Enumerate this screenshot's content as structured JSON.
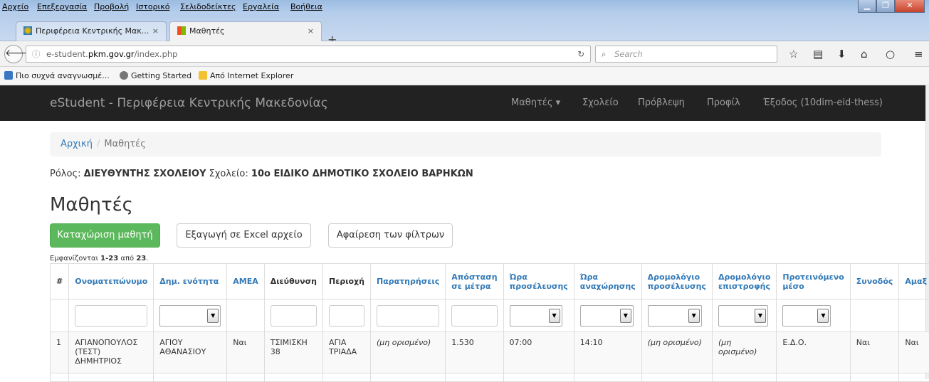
{
  "browser": {
    "menu": [
      "Αρχείο",
      "Επεξεργασία",
      "Προβολή",
      "Ιστορικό",
      "Σελιδοδείκτες",
      "Εργαλεία",
      "Βοήθεια"
    ],
    "tabs": [
      {
        "title": "Περιφέρεια Κεντρικής Μακ...",
        "close": "×"
      },
      {
        "title": "Μαθητές",
        "close": "×"
      }
    ],
    "new_tab": "+",
    "url_prefix": "e-student.",
    "url_domain": "pkm.gov.gr",
    "url_path": "/index.php",
    "search_placeholder": "Search",
    "bookmarks": [
      "Πιο συχνά αναγνωσμέ...",
      "Getting Started",
      "Από Internet Explorer"
    ]
  },
  "app": {
    "brand": "eStudent - Περιφέρεια Κεντρικής Μακεδονίας",
    "nav": [
      "Μαθητές ▾",
      "Σχολείο",
      "Πρόβλεψη",
      "Προφίλ",
      "Έξοδος (10dim-eid-thess)"
    ]
  },
  "breadcrumb": {
    "home": "Αρχική",
    "sep": "/",
    "current": "Μαθητές"
  },
  "role": {
    "role_label": "Ρόλος:",
    "role_value": "ΔΙΕΥΘΥΝΤΗΣ ΣΧΟΛΕΙΟΥ",
    "school_label": "Σχολείο:",
    "school_value": "10ο ΕΙΔΙΚΟ ΔΗΜΟΤΙΚΟ ΣΧΟΛΕΙΟ ΒΑΡΗΚΩΝ"
  },
  "page_title": "Μαθητές",
  "buttons": {
    "add": "Καταχώριση μαθητή",
    "export": "Εξαγωγή σε Excel αρχείο",
    "clear": "Αφαίρεση των φίλτρων"
  },
  "summary": {
    "prefix": "Εμφανίζονται",
    "range": "1-23",
    "mid": "από",
    "total": "23",
    "end": "."
  },
  "table": {
    "headers": [
      "#",
      "Ονοματεπώνυμο",
      "Δημ. ενότητα",
      "ΑΜΕΑ",
      "Διεύθυνση",
      "Περιοχή",
      "Παρατηρήσεις",
      "Απόσταση σε μέτρα",
      "Ώρα προσέλευσης",
      "Ώρα αναχώρησης",
      "Δρομολόγιο προσέλευσης",
      "Δρομολόγιο επιστροφής",
      "Προτεινόμενο μέσο",
      "Συνοδός",
      "Αμαξ"
    ],
    "rows": [
      [
        "1",
        "ΑΓΙΑΝΟΠΟΥΛΟΣ (ΤΕΣΤ) ΔΗΜΗΤΡΙΟΣ",
        "ΑΓΙΟΥ ΑΘΑΝΑΣΙΟΥ",
        "Ναι",
        "ΤΣΙΜΙΣΚΗ 38",
        "ΑΓΙΑ ΤΡΙΑΔΑ",
        "(μη ορισμένο)",
        "1.530",
        "07:00",
        "14:10",
        "(μη ορισμένο)",
        "(μη ορισμένο)",
        "Ε.Δ.Ο.",
        "Ναι",
        "Ναι"
      ]
    ]
  }
}
